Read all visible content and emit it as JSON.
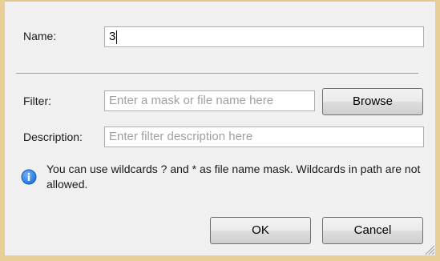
{
  "form": {
    "name_label": "Name:",
    "name_value": "3",
    "filter_label": "Filter:",
    "filter_placeholder": "Enter a mask or file name here",
    "browse_label": "Browse",
    "description_label": "Description:",
    "description_placeholder": "Enter filter description here"
  },
  "info": {
    "icon": "info-icon",
    "text": "You can use wildcards ? and * as file name mask. Wildcards in path are not allowed."
  },
  "buttons": {
    "ok_label": "OK",
    "cancel_label": "Cancel"
  },
  "colors": {
    "frame": "#e8cf97",
    "client": "#f0f0f0",
    "info_icon": "#1f6fd0",
    "placeholder": "#a0a0a0"
  }
}
